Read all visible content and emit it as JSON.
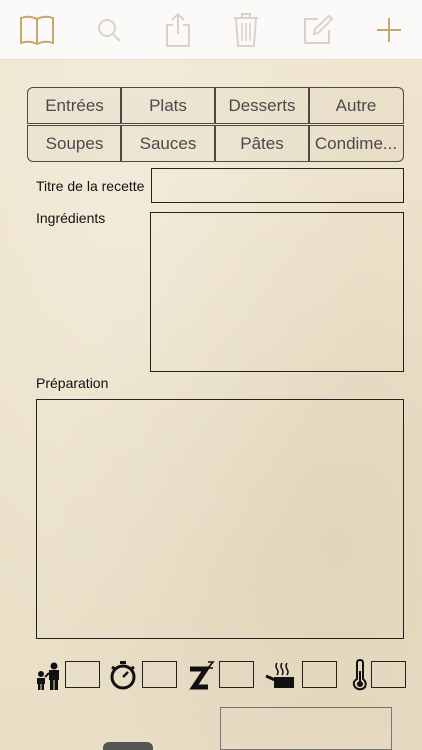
{
  "toolbar": {
    "icons": [
      "book-icon",
      "search-icon",
      "share-icon",
      "trash-icon",
      "compose-icon",
      "plus-icon"
    ],
    "accent_color": "#c8a56a",
    "inactive_color": "#d9d4cb"
  },
  "categories": {
    "row1": [
      "Entrées",
      "Plats",
      "Desserts",
      "Autre"
    ],
    "row2": [
      "Soupes",
      "Sauces",
      "Pâtes",
      "Condime..."
    ]
  },
  "form": {
    "title_label": "Titre de la recette",
    "title_value": "",
    "ingredients_label": "Ingrédients",
    "ingredients_value": "",
    "preparation_label": "Préparation",
    "preparation_value": ""
  },
  "attributes": {
    "icons": [
      "servings-icon",
      "timer-icon",
      "rest-time-icon",
      "cooking-pot-icon",
      "thermometer-icon"
    ],
    "values": [
      "",
      "",
      "",
      "",
      ""
    ]
  }
}
